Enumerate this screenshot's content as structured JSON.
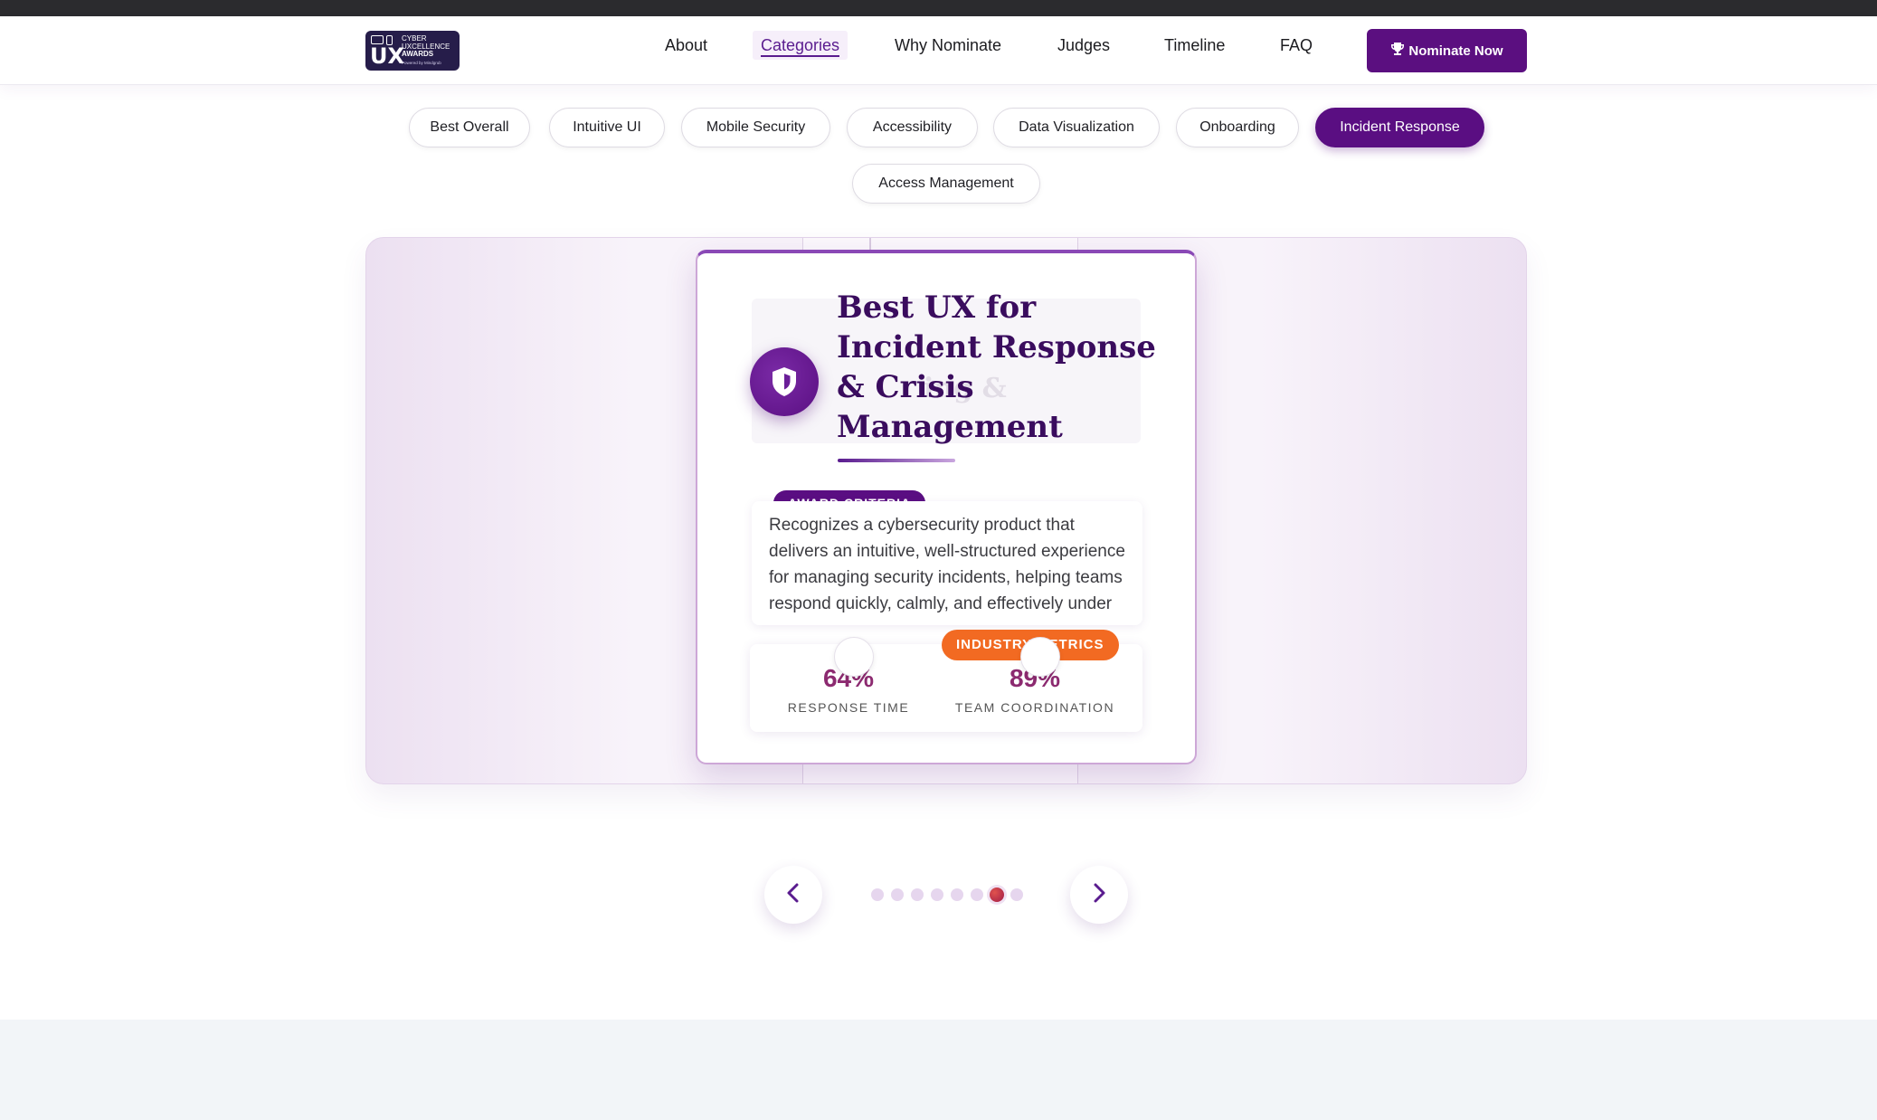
{
  "logo": {
    "ux": "UX",
    "line1": "CYBER",
    "line2": "UXCELLENCE",
    "line3": "AWARDS",
    "line4": "Powered by Mindgrub"
  },
  "nav": {
    "items": [
      "About",
      "Categories",
      "Why Nominate",
      "Judges",
      "Timeline",
      "FAQ"
    ],
    "active": "Categories",
    "cta_label": "Nominate Now",
    "cta_icon": "trophy-icon"
  },
  "categories": {
    "items": [
      "Best Overall",
      "Intuitive UI",
      "Mobile Security",
      "Accessibility",
      "Data Visualization",
      "Onboarding",
      "Incident Response",
      "Access Management"
    ],
    "active": "Incident Response"
  },
  "card": {
    "icon": "shield-icon",
    "title": "Best UX for Incident Response & Crisis Management",
    "ghost_title": "ing &",
    "criteria_badge": "AWARD CRITERIA",
    "description": "Recognizes a cybersecurity product that delivers an intuitive, well-structured experience for managing security incidents, helping teams respond quickly, calmly, and effectively under pressure.",
    "industry_badge": "INDUSTRY METRICS",
    "metrics": [
      {
        "value": "64%",
        "label": "RESPONSE TIME"
      },
      {
        "value": "89%",
        "label": "TEAM COORDINATION"
      }
    ]
  },
  "carousel": {
    "prev_icon": "chevron-left-icon",
    "next_icon": "chevron-right-icon",
    "total": 8,
    "active_index": 6
  },
  "colors": {
    "brand": "#5a0e82",
    "accent": "#f26a22",
    "metric": "#8c2a70"
  }
}
